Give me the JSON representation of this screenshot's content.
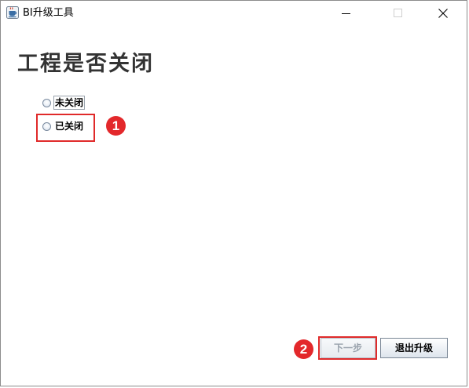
{
  "window": {
    "title": "BI升级工具"
  },
  "page": {
    "title": "工程是否关闭"
  },
  "options": [
    {
      "label": "未关闭",
      "selected": false
    },
    {
      "label": "已关闭",
      "selected": false
    }
  ],
  "annotations": {
    "step1": "1",
    "step2": "2",
    "highlight_color": "#e02a2a",
    "badge_color": "#e3282b"
  },
  "buttons": {
    "next_label": "下一步",
    "next_enabled": false,
    "exit_label": "退出升级"
  },
  "icons": {
    "app": "java-coffee-cup-icon",
    "minimize": "minimize-icon",
    "maximize": "maximize-icon",
    "close": "close-icon"
  }
}
